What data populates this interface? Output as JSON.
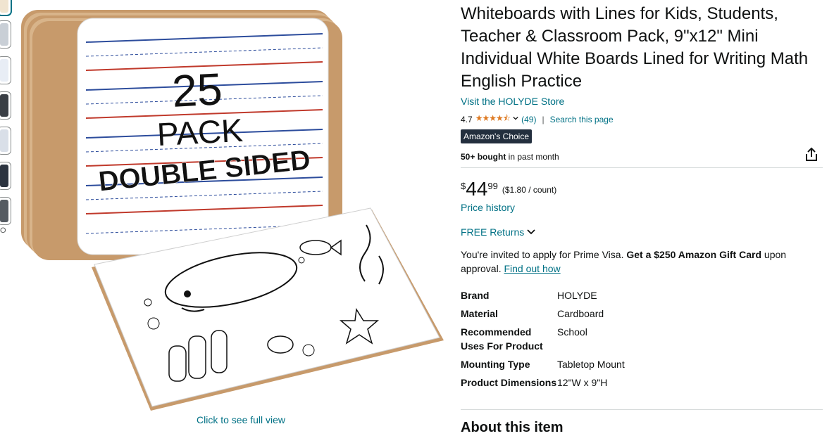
{
  "thumbnails": {
    "items": [
      {
        "name": "thumbnail-1",
        "color": "#f0e4d0"
      },
      {
        "name": "thumbnail-2",
        "color": "#c9cfd6"
      },
      {
        "name": "thumbnail-3",
        "color": "#e8edf5"
      },
      {
        "name": "thumbnail-4",
        "color": "#3a3f45"
      },
      {
        "name": "thumbnail-5",
        "color": "#d9dfe8"
      },
      {
        "name": "thumbnail-6",
        "color": "#2c3440"
      },
      {
        "name": "thumbnail-7",
        "color": "#555b62"
      }
    ],
    "video_label": "O"
  },
  "image": {
    "board_top_text": [
      "25",
      "PACK",
      "DOUBLE SIDED"
    ],
    "full_view_label": "Click to see full view"
  },
  "product": {
    "title": "Whiteboards with Lines for Kids, Students, Teacher & Classroom Pack, 9\"x12\" Mini Individual White Boards Lined for Writing Math English Practice",
    "store_link": "Visit the HOLYDE Store",
    "rating_value": "4.7",
    "stars": "★★★★⯪",
    "review_count": "(49)",
    "search_page": "Search this page",
    "badge": "Amazon's Choice",
    "bought_count": "50+ bought",
    "bought_suffix": " in past month"
  },
  "price": {
    "symbol": "$",
    "whole": "44",
    "fraction": "99",
    "unit_price": "($1.80 / count)",
    "history_link": "Price history"
  },
  "returns": {
    "label": "FREE Returns"
  },
  "prime_offer": {
    "prefix": "You're invited to apply for Prime Visa. ",
    "bold": "Get a $250 Amazon Gift Card",
    "suffix": " upon approval. ",
    "link": "Find out how"
  },
  "specs": [
    {
      "key": "Brand",
      "value": "HOLYDE"
    },
    {
      "key": "Material",
      "value": "Cardboard"
    },
    {
      "key": "Recommended Uses For Product",
      "value": "School"
    },
    {
      "key": "Mounting Type",
      "value": "Tabletop Mount"
    },
    {
      "key": "Product Dimensions",
      "value": "12\"W x 9\"H"
    }
  ],
  "about_heading": "About this item",
  "colors": {
    "link": "#007185",
    "star": "#de7921",
    "badge_bg": "#232f3e",
    "line_red": "#c0392b",
    "line_blue": "#2c4c9c"
  }
}
